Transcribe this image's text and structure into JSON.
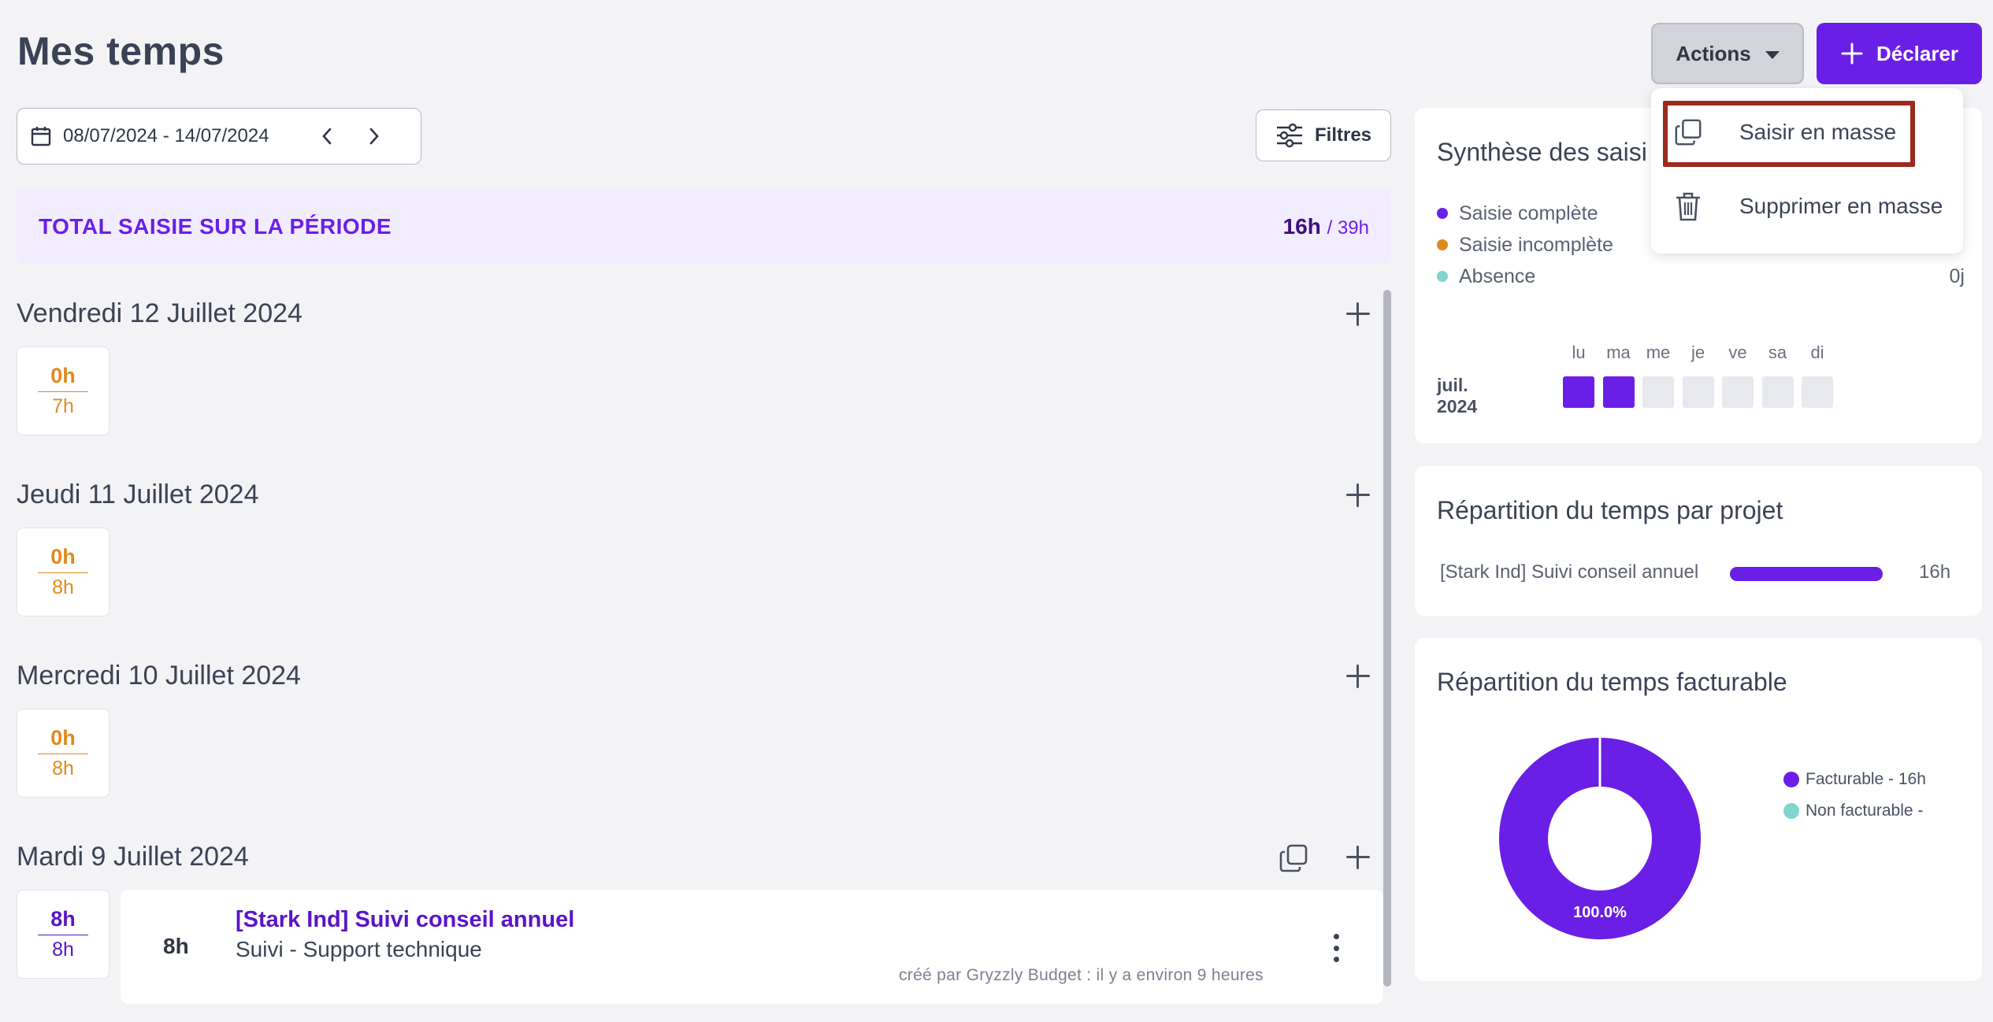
{
  "header": {
    "title": "Mes temps",
    "actions_label": "Actions",
    "declare_label": "Déclarer"
  },
  "actions_menu": {
    "items": [
      {
        "label": "Saisir en masse",
        "icon": "copy-icon"
      },
      {
        "label": "Supprimer en masse",
        "icon": "trash-icon"
      }
    ]
  },
  "toolbar": {
    "date_range": "08/07/2024 - 14/07/2024",
    "filters_label": "Filtres"
  },
  "total": {
    "label": "TOTAL SAISIE SUR LA PÉRIODE",
    "done": "16h",
    "expected": "/ 39h"
  },
  "days": [
    {
      "title": "Vendredi 12 Juillet 2024",
      "done": "0h",
      "expected": "7h",
      "status": "incomplete"
    },
    {
      "title": "Jeudi 11 Juillet 2024",
      "done": "0h",
      "expected": "8h",
      "status": "incomplete"
    },
    {
      "title": "Mercredi 10 Juillet 2024",
      "done": "0h",
      "expected": "8h",
      "status": "incomplete"
    },
    {
      "title": "Mardi 9 Juillet 2024",
      "done": "8h",
      "expected": "8h",
      "status": "complete",
      "entries": [
        {
          "hours": "8h",
          "project": "[Stark Ind] Suivi conseil annuel",
          "task": "Suivi - Support technique",
          "meta": "créé par Gryzzly Budget : il y a environ 9 heures"
        }
      ]
    }
  ],
  "synthese": {
    "title": "Synthèse des saisi",
    "legend": [
      {
        "label": "Saisie complète",
        "color": "#6a1fe6"
      },
      {
        "label": "Saisie incomplète",
        "color": "#e08a1e"
      },
      {
        "label": "Absence",
        "color": "#7fd6d0",
        "value": "0j"
      }
    ],
    "calendar": {
      "month": "juil. 2024",
      "weekdays": [
        "lu",
        "ma",
        "me",
        "je",
        "ve",
        "sa",
        "di"
      ],
      "states": [
        "complete",
        "complete",
        "empty",
        "empty",
        "empty",
        "empty",
        "empty"
      ]
    }
  },
  "project_split": {
    "title": "Répartition du temps par projet",
    "rows": [
      {
        "label": "[Stark Ind] Suivi conseil annuel",
        "value": "16h",
        "fraction": 1.0
      }
    ]
  },
  "billable": {
    "title": "Répartition du temps facturable",
    "legend": [
      {
        "label": "Facturable - 16h",
        "color": "#6a1fe6"
      },
      {
        "label": "Non facturable -",
        "color": "#7fd6d0"
      }
    ],
    "center_label": "100.0%"
  },
  "chart_data": {
    "type": "pie",
    "title": "Répartition du temps facturable",
    "categories": [
      "Facturable - 16h",
      "Non facturable -"
    ],
    "values": [
      100.0,
      0.0
    ],
    "data_labels": [
      "100.0%"
    ],
    "legend_position": "right"
  },
  "colors": {
    "accent": "#6a1fe6",
    "incomplete": "#e08a1e",
    "absence": "#7fd6d0",
    "highlight": "#9c2a1d"
  }
}
